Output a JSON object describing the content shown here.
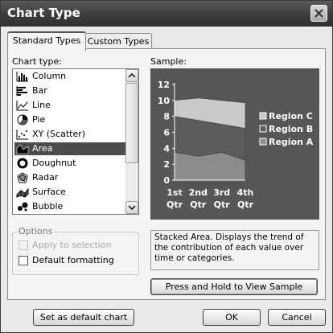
{
  "window": {
    "title": "Chart Type"
  },
  "tabs": [
    {
      "label": "Standard Types",
      "active": true
    },
    {
      "label": "Custom Types",
      "active": false
    }
  ],
  "chart_type_label": "Chart type:",
  "chart_types": [
    {
      "label": "Column",
      "icon": "column-chart-icon",
      "selected": false
    },
    {
      "label": "Bar",
      "icon": "bar-chart-icon",
      "selected": false
    },
    {
      "label": "Line",
      "icon": "line-chart-icon",
      "selected": false
    },
    {
      "label": "Pie",
      "icon": "pie-chart-icon",
      "selected": false
    },
    {
      "label": "XY (Scatter)",
      "icon": "scatter-chart-icon",
      "selected": false
    },
    {
      "label": "Area",
      "icon": "area-chart-icon",
      "selected": true
    },
    {
      "label": "Doughnut",
      "icon": "doughnut-chart-icon",
      "selected": false
    },
    {
      "label": "Radar",
      "icon": "radar-chart-icon",
      "selected": false
    },
    {
      "label": "Surface",
      "icon": "surface-chart-icon",
      "selected": false
    },
    {
      "label": "Bubble",
      "icon": "bubble-chart-icon",
      "selected": false
    }
  ],
  "sample_label": "Sample:",
  "options": {
    "legend": "Options",
    "apply_to_selection": {
      "label": "Apply to selection",
      "checked": false,
      "enabled": false
    },
    "default_formatting": {
      "label": "Default formatting",
      "checked": false,
      "enabled": true
    }
  },
  "description": "Stacked Area. Displays the trend of the contribution of each value over time or categories.",
  "buttons": {
    "press_hold": "Press and Hold to View Sample",
    "set_default": "Set as default chart",
    "ok": "OK",
    "cancel": "Cancel"
  },
  "colors": {
    "sample_background": "#565656",
    "region_a": "#8c8c8c",
    "region_b": "#5c5c5c",
    "region_c": "#c9c9c9",
    "selection": "#4c4c4c"
  },
  "chart_data": {
    "type": "area",
    "stacked": true,
    "categories": [
      "1st Qtr",
      "2nd Qtr",
      "3rd Qtr",
      "4th Qtr"
    ],
    "series": [
      {
        "name": "Region A",
        "values": [
          3.5,
          3.0,
          3.5,
          2.5
        ]
      },
      {
        "name": "Region B",
        "values": [
          4.5,
          4.5,
          3.5,
          4.0
        ]
      },
      {
        "name": "Region C",
        "values": [
          2.0,
          2.8,
          3.0,
          3.2
        ]
      }
    ],
    "ylim": [
      0,
      12
    ],
    "yticks": [
      "0",
      "2",
      "4",
      "6",
      "8",
      "10",
      "12"
    ],
    "grid": false,
    "legend": "right",
    "legend_entries": [
      "Region C",
      "Region B",
      "Region A"
    ]
  }
}
